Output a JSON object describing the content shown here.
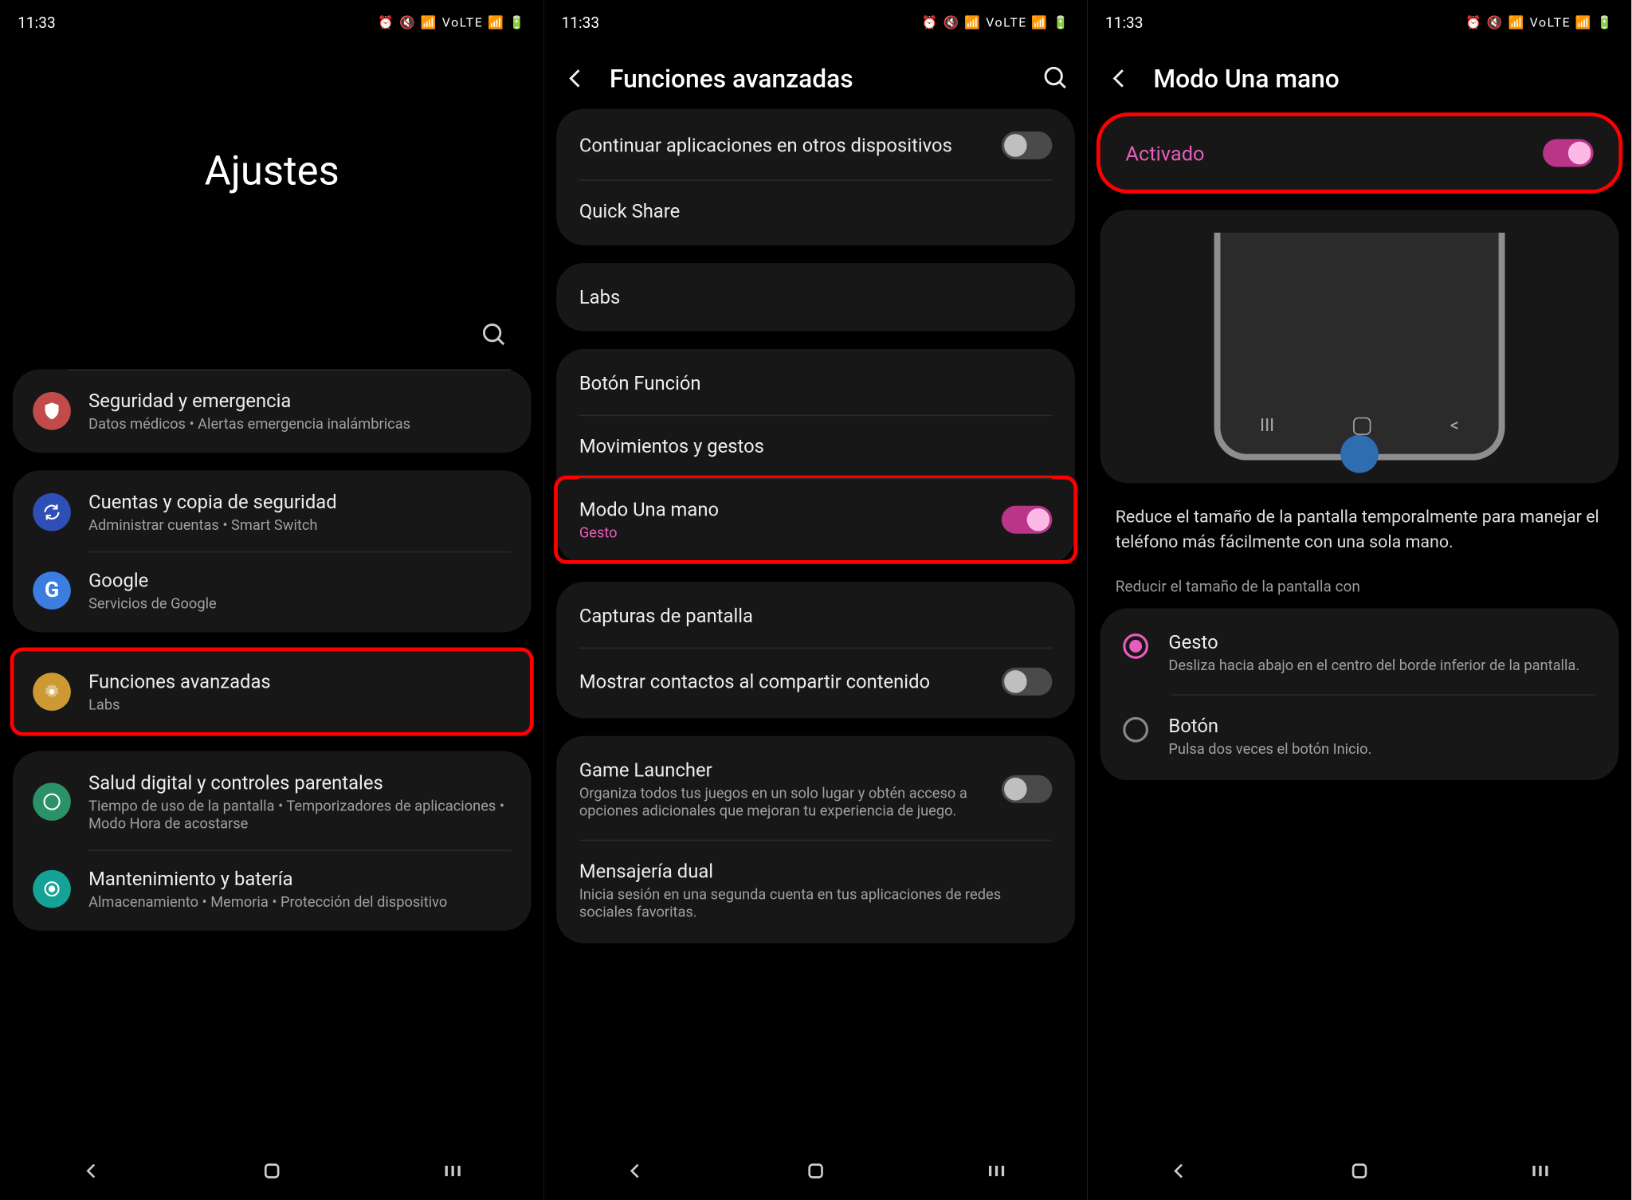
{
  "status": {
    "time": "11:33",
    "icons": "⏰ 🔇 📶 VoLTE 📶 🔋"
  },
  "screen1": {
    "title": "Ajustes",
    "groups": [
      {
        "dividerTop": true,
        "rows": [
          {
            "icon": "shield",
            "bg": "#c14b4b",
            "title": "Seguridad y emergencia",
            "sub": "Datos médicos  •  Alertas emergencia inalámbricas"
          }
        ]
      },
      {
        "rows": [
          {
            "icon": "sync",
            "bg": "#2f4fb8",
            "title": "Cuentas y copia de seguridad",
            "sub": "Administrar cuentas  •  Smart Switch"
          },
          {
            "icon": "google",
            "bg": "#fff",
            "title": "Google",
            "sub": "Servicios de Google"
          }
        ]
      },
      {
        "highlight": true,
        "rows": [
          {
            "icon": "gear",
            "bg": "#cc9933",
            "title": "Funciones avanzadas",
            "sub": "Labs"
          }
        ]
      },
      {
        "rows": [
          {
            "icon": "wellbeing",
            "bg": "#2b9166",
            "title": "Salud digital y controles parentales",
            "sub": "Tiempo de uso de la pantalla  •  Temporizadores de aplicaciones  •  Modo Hora de acostarse"
          },
          {
            "icon": "care",
            "bg": "#14a396",
            "title": "Mantenimiento y batería",
            "sub": "Almacenamiento  •  Memoria  •  Protección del dispositivo"
          }
        ]
      }
    ]
  },
  "screen2": {
    "title": "Funciones avanzadas",
    "groups": [
      [
        {
          "title": "Continuar aplicaciones en otros dispositivos",
          "toggle": "off"
        },
        {
          "title": "Quick Share"
        }
      ],
      [
        {
          "title": "Labs"
        }
      ],
      [
        {
          "title": "Botón Función"
        },
        {
          "title": "Movimientos y gestos"
        },
        {
          "title": "Modo Una mano",
          "accent": "Gesto",
          "toggle": "on",
          "highlight": true
        }
      ],
      [
        {
          "title": "Capturas de pantalla"
        },
        {
          "title": "Mostrar contactos al compartir contenido",
          "toggle": "off"
        }
      ],
      [
        {
          "title": "Game Launcher",
          "sub": "Organiza todos tus juegos en un solo lugar y obtén acceso a opciones adicionales que mejoran tu experiencia de juego.",
          "toggle": "off"
        },
        {
          "title": "Mensajería dual",
          "sub": "Inicia sesión en una segunda cuenta en tus aplicaciones de redes sociales favoritas."
        }
      ]
    ]
  },
  "screen3": {
    "title": "Modo Una mano",
    "activated": "Activado",
    "description": "Reduce el tamaño de la pantalla temporalmente para manejar el teléfono más fácilmente con una sola mano.",
    "sectionTitle": "Reducir el tamaño de la pantalla con",
    "options": [
      {
        "title": "Gesto",
        "sub": "Desliza hacia abajo en el centro del borde inferior de la pantalla.",
        "checked": true
      },
      {
        "title": "Botón",
        "sub": "Pulsa dos veces el botón Inicio.",
        "checked": false
      }
    ]
  }
}
